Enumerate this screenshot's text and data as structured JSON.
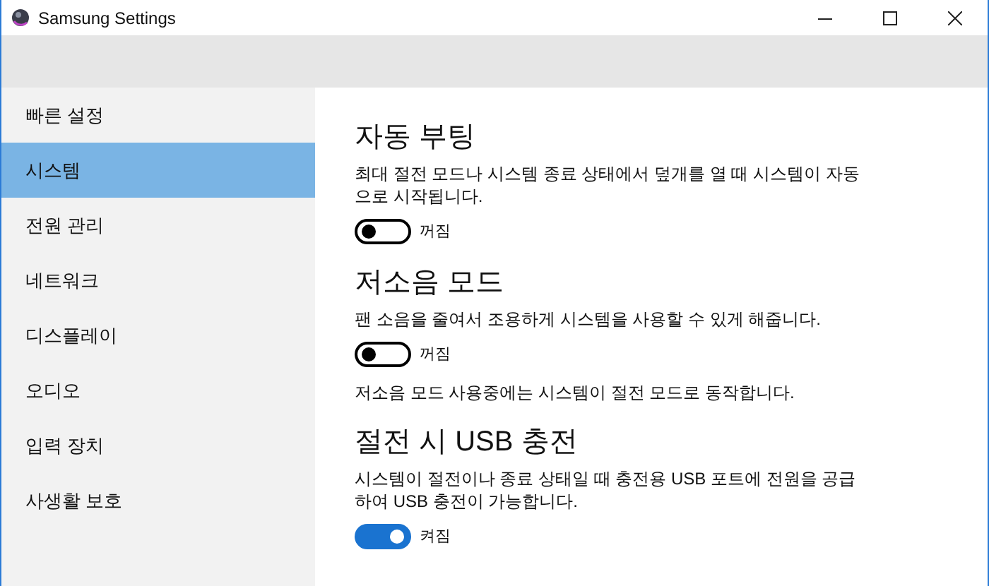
{
  "window": {
    "title": "Samsung Settings"
  },
  "sidebar": {
    "items": [
      {
        "label": "빠른 설정",
        "selected": false
      },
      {
        "label": "시스템",
        "selected": true
      },
      {
        "label": "전원 관리",
        "selected": false
      },
      {
        "label": "네트워크",
        "selected": false
      },
      {
        "label": "디스플레이",
        "selected": false
      },
      {
        "label": "오디오",
        "selected": false
      },
      {
        "label": "입력 장치",
        "selected": false
      },
      {
        "label": "사생활 보호",
        "selected": false
      }
    ]
  },
  "sections": [
    {
      "title": "자동 부팅",
      "description": "최대 절전 모드나 시스템 종료 상태에서 덮개를 열 때 시스템이 자동으로 시작됩니다.",
      "toggle": {
        "on": false,
        "label": "꺼짐"
      }
    },
    {
      "title": "저소음 모드",
      "description": "팬 소음을 줄여서 조용하게 시스템을 사용할 수 있게 해줍니다.",
      "toggle": {
        "on": false,
        "label": "꺼짐"
      },
      "note": "저소음 모드 사용중에는 시스템이 절전 모드로 동작합니다."
    },
    {
      "title": "절전 시 USB 충전",
      "description": "시스템이 절전이나 종료 상태일 때 충전용 USB 포트에 전원을 공급하여 USB 충전이 가능합니다.",
      "toggle": {
        "on": true,
        "label": "켜짐"
      }
    }
  ]
}
